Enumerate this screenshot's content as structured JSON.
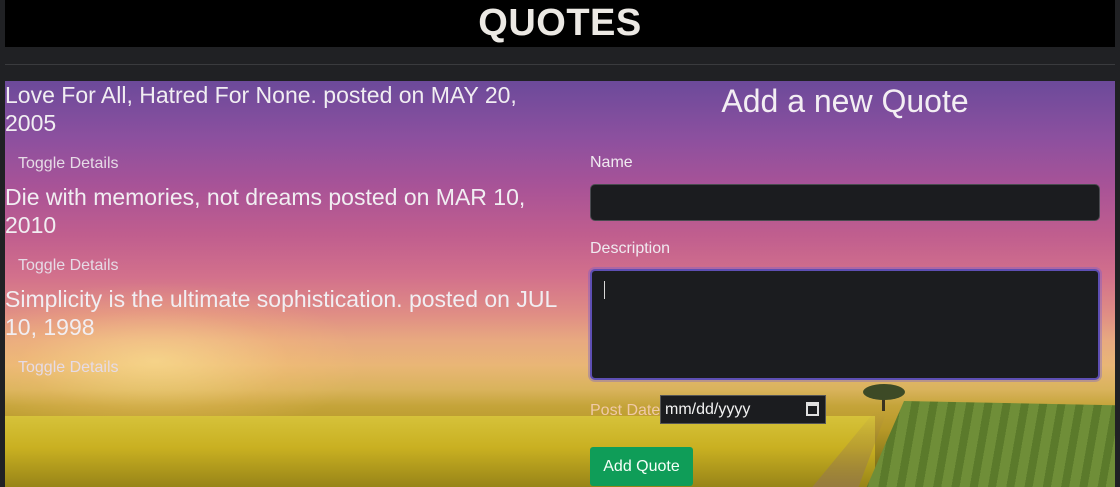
{
  "header": {
    "title": "QUOTES"
  },
  "quotes": [
    {
      "text": "Love For All, Hatred For None. posted on MAY 20, 2005",
      "toggle_label": "Toggle Details"
    },
    {
      "text": "Die with memories, not dreams posted on MAR 10, 2010",
      "toggle_label": "Toggle Details"
    },
    {
      "text": "Simplicity is the ultimate sophistication. posted on JUL 10, 1998",
      "toggle_label": "Toggle Details"
    }
  ],
  "form": {
    "title": "Add a new Quote",
    "name_label": "Name",
    "name_value": "",
    "description_label": "Description",
    "description_value": "",
    "post_date_label": "Post Date",
    "post_date_placeholder": "mm/dd/yyyy",
    "submit_label": "Add Quote"
  },
  "icons": {
    "calendar": "calendar-icon"
  },
  "colors": {
    "submit_button": "#0f9d58",
    "header_bg": "#000000",
    "focus_ring": "#5e4fb3"
  }
}
